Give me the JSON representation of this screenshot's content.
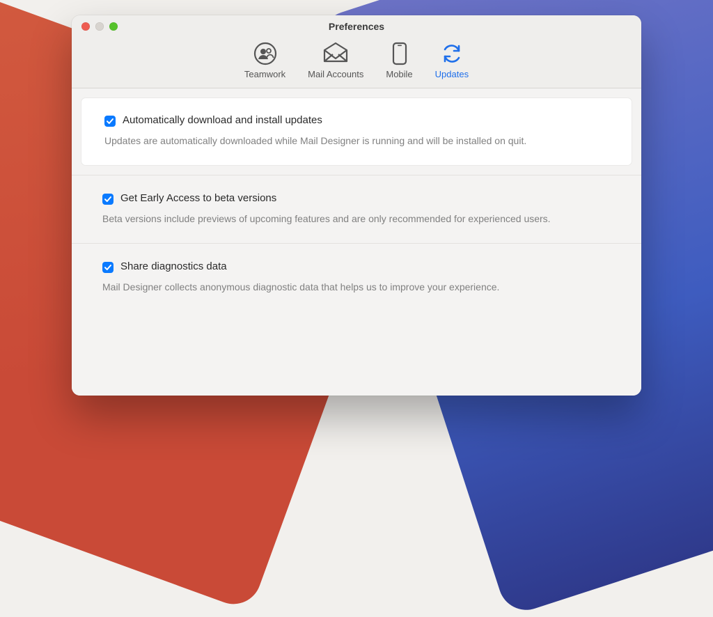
{
  "window": {
    "title": "Preferences"
  },
  "tabs": {
    "teamwork": "Teamwork",
    "mailAccounts": "Mail Accounts",
    "mobile": "Mobile",
    "updates": "Updates"
  },
  "options": {
    "autoUpdate": {
      "label": "Automatically download and install updates",
      "desc": "Updates are automatically downloaded while Mail Designer is running and will be installed on quit.",
      "checked": true
    },
    "earlyAccess": {
      "label": "Get Early Access to beta versions",
      "desc": "Beta versions include previews of upcoming features and are only recommended for experienced users.",
      "checked": true
    },
    "diagnostics": {
      "label": "Share diagnostics data",
      "desc": "Mail Designer collects anonymous diagnostic data that helps us to improve your experience.",
      "checked": true
    }
  }
}
